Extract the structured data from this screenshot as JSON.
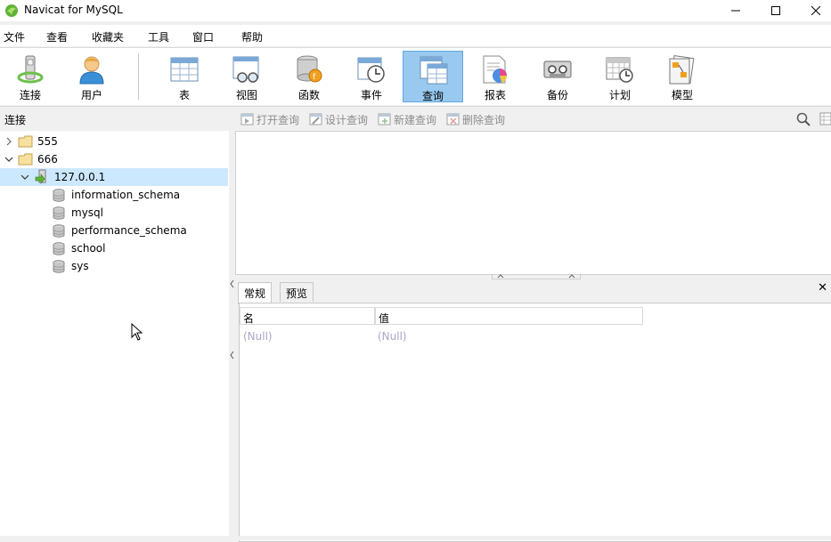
{
  "window": {
    "title": "Navicat for MySQL",
    "minimize_glyph": "─",
    "maximize_glyph": "☐",
    "close_glyph": "✕"
  },
  "menu": {
    "items": [
      "文件",
      "查看",
      "收藏夹",
      "工具",
      "窗口",
      "帮助"
    ]
  },
  "toolbar": {
    "buttons": [
      {
        "label": "连接",
        "icon": "connection-icon"
      },
      {
        "label": "用户",
        "icon": "user-icon"
      },
      {
        "label": "表",
        "icon": "table-icon"
      },
      {
        "label": "视图",
        "icon": "view-icon"
      },
      {
        "label": "函数",
        "icon": "function-icon"
      },
      {
        "label": "事件",
        "icon": "event-icon"
      },
      {
        "label": "查询",
        "icon": "query-icon",
        "active": true
      },
      {
        "label": "报表",
        "icon": "report-icon"
      },
      {
        "label": "备份",
        "icon": "backup-icon"
      },
      {
        "label": "计划",
        "icon": "schedule-icon"
      },
      {
        "label": "模型",
        "icon": "model-icon"
      }
    ]
  },
  "sidebar": {
    "header": "连接",
    "tree": [
      {
        "label": "555",
        "type": "group",
        "expanded": false
      },
      {
        "label": "666",
        "type": "group",
        "expanded": true
      },
      {
        "label": "127.0.0.1",
        "type": "connection",
        "expanded": true,
        "selected": true
      },
      {
        "label": "information_schema",
        "type": "database"
      },
      {
        "label": "mysql",
        "type": "database"
      },
      {
        "label": "performance_schema",
        "type": "database"
      },
      {
        "label": "school",
        "type": "database"
      },
      {
        "label": "sys",
        "type": "database"
      }
    ]
  },
  "object_toolbar": {
    "buttons": [
      "打开查询",
      "设计查询",
      "新建查询",
      "删除查询"
    ]
  },
  "info_panel": {
    "tabs": [
      "常规",
      "预览"
    ],
    "active_tab": "常规",
    "columns": [
      "名",
      "值"
    ],
    "row": [
      "(Null)",
      "(Null)"
    ]
  },
  "colors": {
    "selected_row": "#cce8ff",
    "active_toolbar": "#99c9ef",
    "null_text": "#a8a8c8"
  }
}
